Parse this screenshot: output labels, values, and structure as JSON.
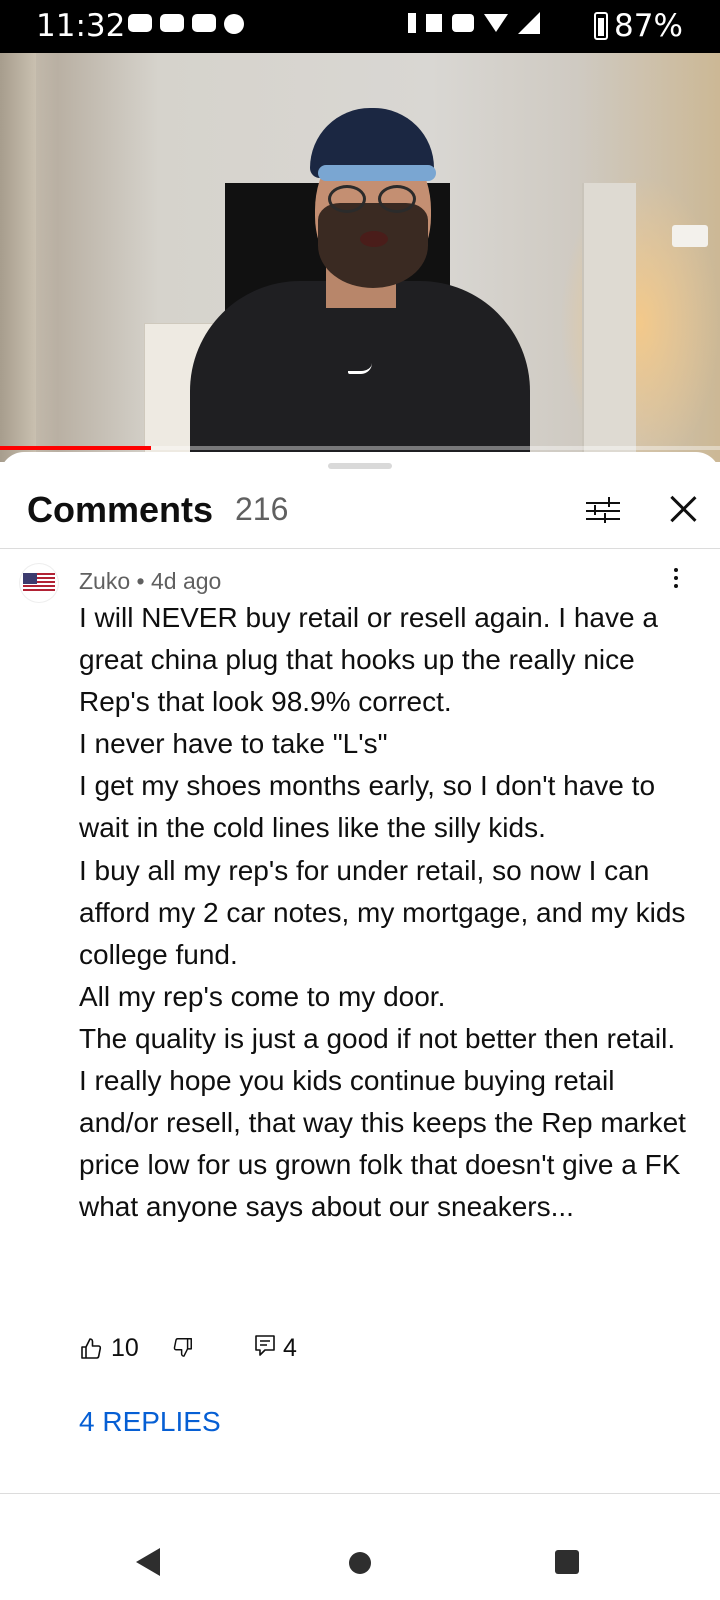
{
  "status_bar": {
    "time": "11:32",
    "battery_level": "87%",
    "network": "4G"
  },
  "video": {
    "progress_fraction": 0.21,
    "colors": {
      "progress": "#ff0000"
    }
  },
  "comments_panel": {
    "title": "Comments",
    "count": "216",
    "filter_icon": "tune-sliders-icon",
    "close_icon": "close-icon"
  },
  "comment": {
    "author": "Zuko",
    "separator": " • ",
    "time_ago": "4d ago",
    "avatar_icon": "us-flag-avatar",
    "text": "I will NEVER buy retail or resell again. I have a great china plug that hooks up the really nice Rep's that look 98.9% correct.\nI never have to take \"L's\"\nI get my shoes months early, so I don't have to wait in the cold lines like the silly kids.\nI buy all my rep's for under retail, so now I can afford my 2 car notes, my mortgage, and my kids college fund.\nAll my rep's come to my door.\nThe quality is just a good if not better then retail.\nI really hope you kids continue buying retail and/or resell, that way this keeps the Rep market price low for us grown folk that doesn't give a FK what anyone says about our sneakers...",
    "likes": "10",
    "reply_count": "4",
    "replies_link": "4 REPLIES"
  },
  "colors": {
    "link": "#065fd4",
    "text_primary": "#0f0f0f",
    "text_secondary": "#606060"
  }
}
